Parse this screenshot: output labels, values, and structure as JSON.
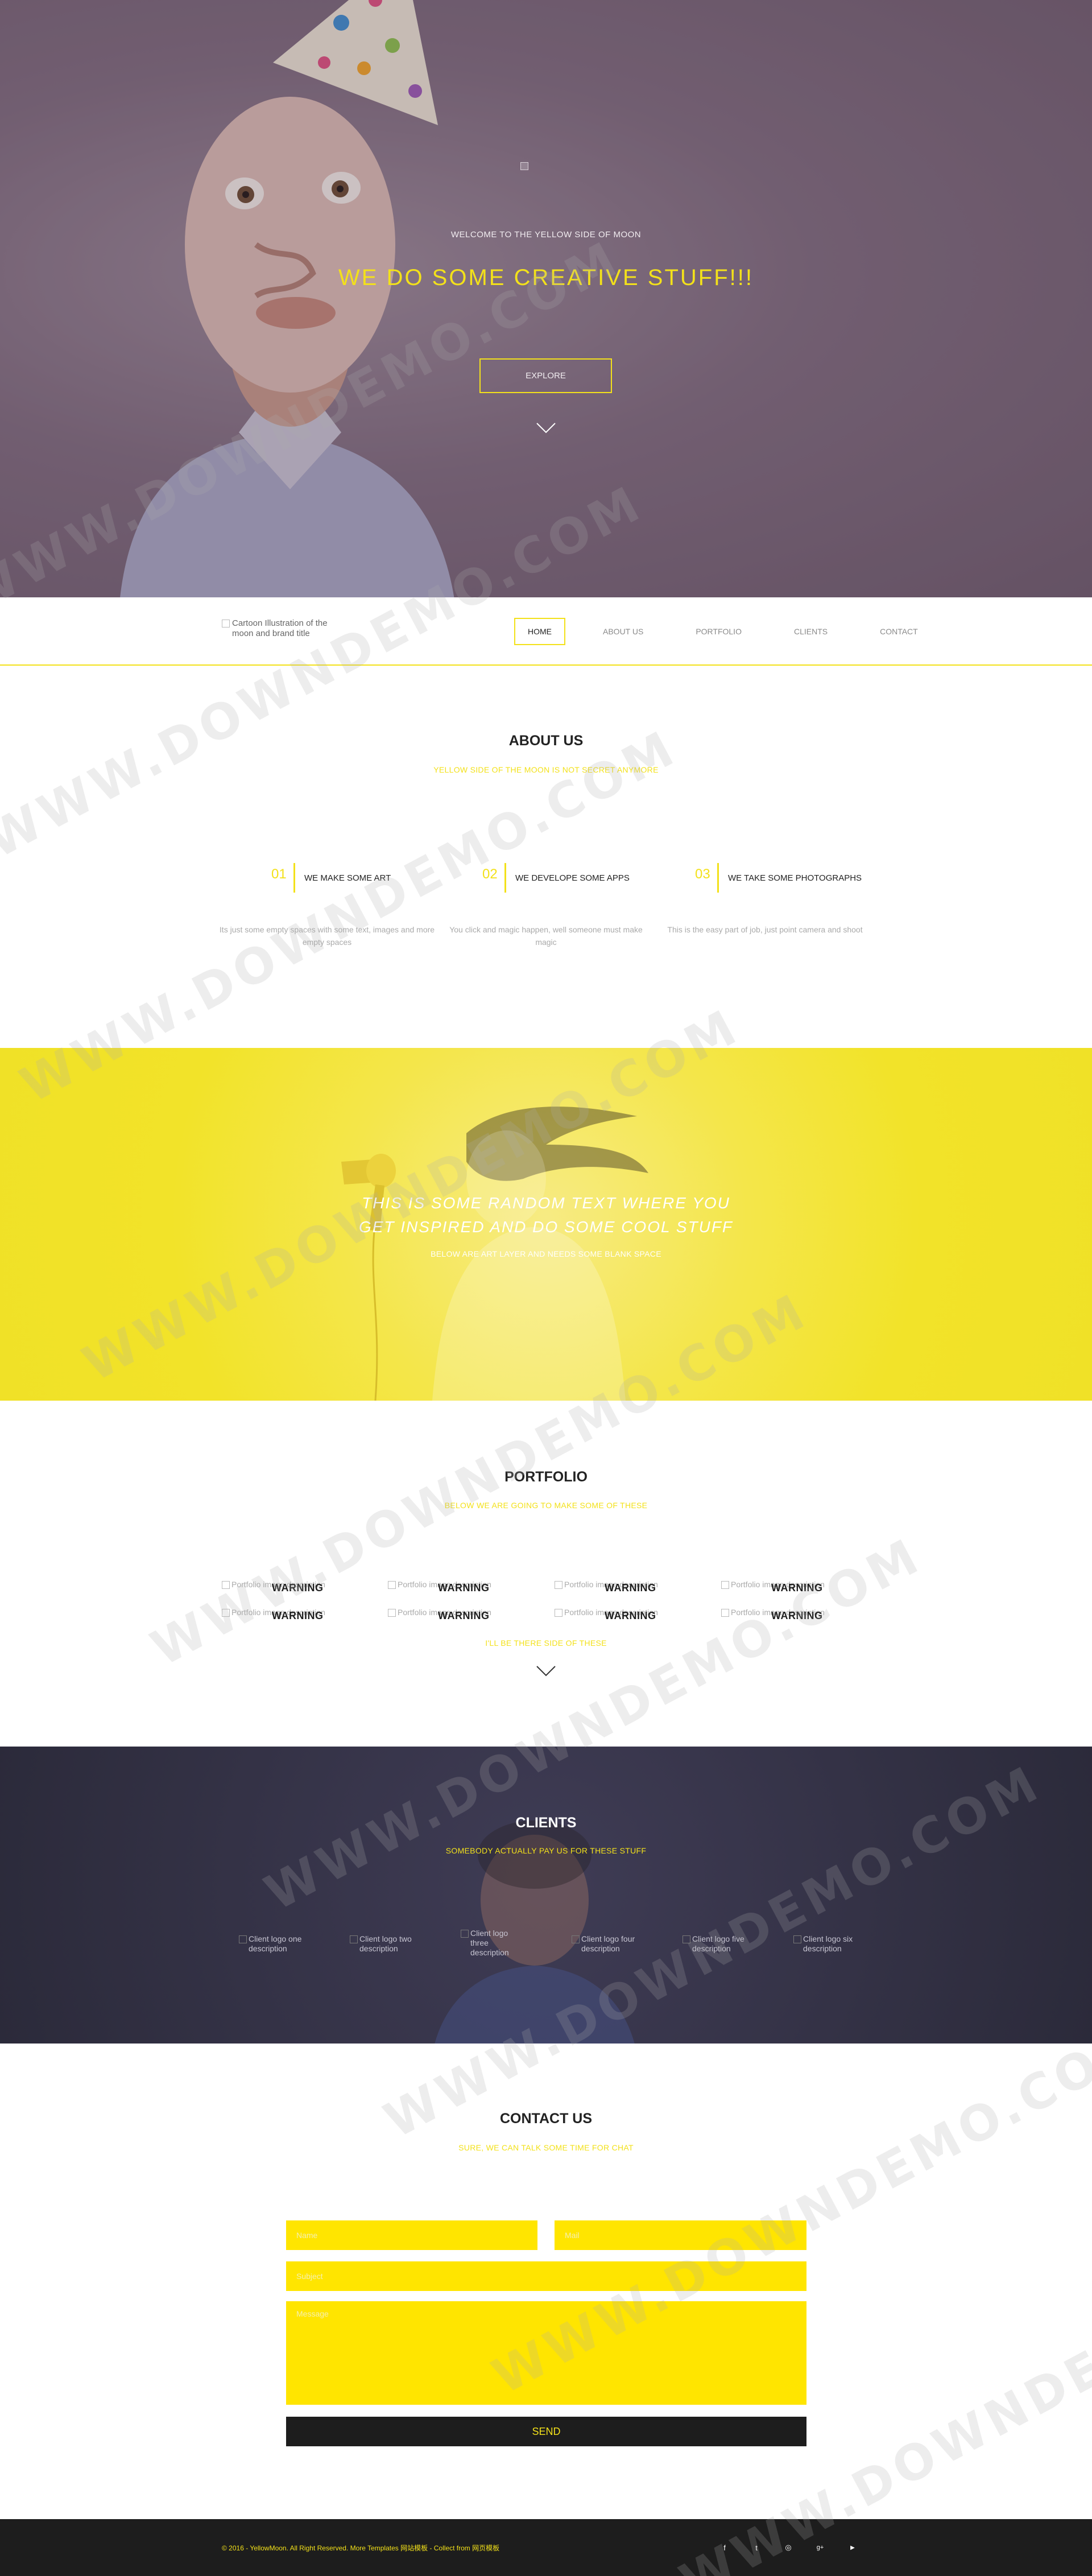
{
  "hero": {
    "welcome": "WELCOME TO THE YELLOW SIDE OF MOON",
    "title": "WE DO SOME CREATIVE STUFF!!!",
    "button": "EXPLORE"
  },
  "nav": {
    "brand_alt": "Cartoon Illustration of the moon and brand title",
    "items": [
      {
        "label": "HOME",
        "active": true
      },
      {
        "label": "ABOUT US"
      },
      {
        "label": "PORTFOLIO"
      },
      {
        "label": "CLIENTS"
      },
      {
        "label": "CONTACT"
      }
    ]
  },
  "about": {
    "title": "ABOUT US",
    "subtitle": "YELLOW SIDE OF THE MOON IS NOT SECRET ANYMORE",
    "features": [
      {
        "num": "01",
        "title": "WE MAKE SOME ART",
        "desc": "Its just some empty spaces with some text, images and more empty spaces"
      },
      {
        "num": "02",
        "title": "WE DEVELOPE SOME APPS",
        "desc": "You click and magic happen, well someone must make magic"
      },
      {
        "num": "03",
        "title": "WE TAKE SOME PHOTOGRAPHS",
        "desc": "This is the easy part of job, just point camera and shoot"
      }
    ]
  },
  "quote": {
    "line1": "THIS IS SOME RANDOM TEXT WHERE YOU",
    "line2": "GET INSPIRED AND DO SOME COOL STUFF",
    "sub": "BELOW ARE ART LAYER AND NEEDS SOME BLANK SPACE"
  },
  "portfolio": {
    "title": "PORTFOLIO",
    "subtitle": "BELOW WE ARE GOING TO MAKE SOME OF THESE",
    "note": "I'LL BE THERE SIDE OF THESE",
    "items": [
      {
        "alt": "Portfolio image description",
        "label": "WARNING"
      },
      {
        "alt": "Portfolio image description",
        "label": "WARNING"
      },
      {
        "alt": "Portfolio image description",
        "label": "WARNING"
      },
      {
        "alt": "Portfolio image description",
        "label": "WARNING"
      },
      {
        "alt": "Portfolio image description",
        "label": "WARNING"
      },
      {
        "alt": "Portfolio image description",
        "label": "WARNING"
      },
      {
        "alt": "Portfolio image description",
        "label": "WARNING"
      },
      {
        "alt": "Portfolio image description",
        "label": "WARNING"
      }
    ]
  },
  "clients": {
    "title": "CLIENTS",
    "subtitle": "SOMEBODY ACTUALLY PAY US FOR THESE STUFF",
    "logos": [
      "Client logo one description",
      "Client logo two description",
      "Client logo three description",
      "Client logo four description",
      "Client logo five description",
      "Client logo six description"
    ]
  },
  "contact": {
    "title": "CONTACT US",
    "subtitle": "SURE, WE CAN TALK SOME TIME FOR CHAT",
    "name_placeholder": "Name",
    "mail_placeholder": "Mail",
    "subject_placeholder": "Subject",
    "message_placeholder": "Message",
    "send": "SEND"
  },
  "footer": {
    "copyright": "© 2016 - YellowMoon. All Right Reserved. More Templates 网站模板 - Collect from 网页模板",
    "social": [
      {
        "icon": "facebook-icon",
        "glyph": "f"
      },
      {
        "icon": "twitter-icon",
        "glyph": "t"
      },
      {
        "icon": "dribbble-icon",
        "glyph": "◎"
      },
      {
        "icon": "google-plus-icon",
        "glyph": "g+"
      },
      {
        "icon": "youtube-icon",
        "glyph": "▶"
      }
    ]
  },
  "watermark": "WWW.DOWNDEMO.COM",
  "colors": {
    "accent": "#f3e11a",
    "field": "#ffe500",
    "dark": "#1d1d1d"
  }
}
